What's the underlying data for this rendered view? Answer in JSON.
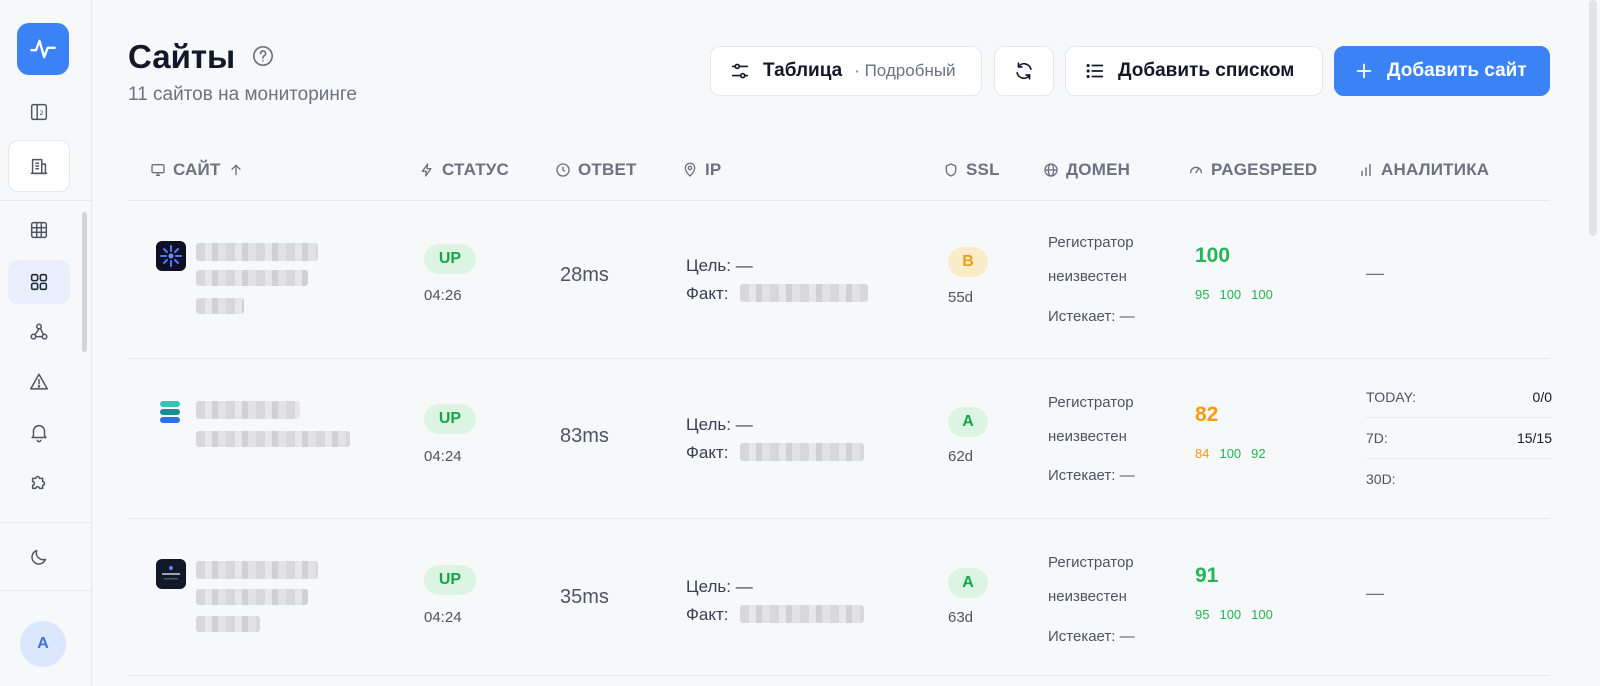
{
  "header": {
    "title": "Сайты",
    "subtitle": "11 сайтов на мониторинге"
  },
  "toolbar": {
    "view_label": "Таблица",
    "view_mode": "· Подробный",
    "add_list_label": "Добавить списком",
    "add_site_label": "Добавить сайт"
  },
  "columns": {
    "site": "САЙТ",
    "status": "СТАТУС",
    "response": "ОТВЕТ",
    "ip": "IP",
    "ssl": "SSL",
    "domain": "ДОМЕН",
    "pagespeed": "PAGESPEED",
    "analytics": "АНАЛИТИКА"
  },
  "labels": {
    "target": "Цель: —",
    "actual": "Факт:",
    "registrar_1": "Регистратор",
    "registrar_2": "неизвестен",
    "expires": "Истекает: —",
    "analytics_empty": "—"
  },
  "rows": [
    {
      "status": "UP",
      "time": "04:26",
      "response": "28ms",
      "ssl_grade": "B",
      "ssl_days": "55d",
      "ps_score": "100",
      "ps_sub": [
        "95",
        "100",
        "100"
      ]
    },
    {
      "status": "UP",
      "time": "04:24",
      "response": "83ms",
      "ssl_grade": "A",
      "ssl_days": "62d",
      "ps_score": "82",
      "ps_sub": [
        "84",
        "100",
        "92"
      ],
      "analytics": [
        {
          "k": "TODAY:",
          "v": "0/0"
        },
        {
          "k": "7D:",
          "v": "15/15"
        },
        {
          "k": "30D:",
          "v": ""
        }
      ]
    },
    {
      "status": "UP",
      "time": "04:24",
      "response": "35ms",
      "ssl_grade": "A",
      "ssl_days": "63d",
      "ps_score": "91",
      "ps_sub": [
        "95",
        "100",
        "100"
      ]
    }
  ],
  "user": {
    "avatar_initial": "A"
  },
  "colors": {
    "accent": "#3b82f6",
    "up": "#16a34a",
    "warn": "#f59e0b"
  }
}
